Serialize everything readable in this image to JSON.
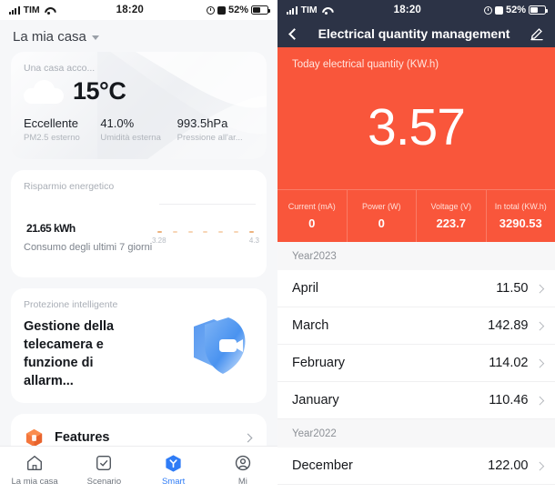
{
  "left": {
    "status_bar": {
      "carrier": "TIM",
      "time": "18:20",
      "battery_pct": "52%",
      "signal_icon": "signal-bars-icon",
      "wifi_icon": "wifi-icon",
      "location_icon": "location-icon",
      "alarm_icon": "alarm-icon",
      "battery_icon": "battery-icon"
    },
    "header": {
      "title": "La mia casa",
      "caret_icon": "chevron-down-icon"
    },
    "weather_card": {
      "label": "Una casa acco...",
      "icon": "cloud-icon",
      "temperature": "15°C",
      "stats": [
        {
          "value": "Eccellente",
          "key": "PM2.5 esterno"
        },
        {
          "value": "41.0%",
          "key": "Umidità esterna"
        },
        {
          "value": "993.5hPa",
          "key": "Pressione all'ar..."
        }
      ]
    },
    "energy_card": {
      "label": "Risparmio energetico",
      "value": "21.65",
      "unit": "kWh",
      "subtitle": "Consumo degli ultimi 7 giorni",
      "chart_min": "3.28",
      "chart_max": "4.3"
    },
    "protection_card": {
      "label": "Protezione intelligente",
      "title": "Gestione della telecamera e funzione di allarm...",
      "icon": "shield-camera-icon"
    },
    "features_row": {
      "icon": "orange-cube-icon",
      "label": "Features",
      "chevron_icon": "chevron-right-icon"
    },
    "tabbar": [
      {
        "label": "La mia casa",
        "icon": "home-icon",
        "active": false
      },
      {
        "label": "Scenario",
        "icon": "checkbox-icon",
        "active": false
      },
      {
        "label": "Smart",
        "icon": "smart-hex-icon",
        "active": true
      },
      {
        "label": "Mi",
        "icon": "person-circle-icon",
        "active": false
      }
    ],
    "colors": {
      "accent": "#2f7cf6",
      "card_bg": "#ffffff",
      "page_bg": "#f6f7f9"
    }
  },
  "right": {
    "status_bar": {
      "carrier": "TIM",
      "time": "18:20",
      "battery_pct": "52%",
      "signal_icon": "signal-bars-icon",
      "wifi_icon": "wifi-icon",
      "location_icon": "location-icon",
      "alarm_icon": "alarm-icon",
      "battery_icon": "battery-icon"
    },
    "nav": {
      "back_icon": "back-chevron-icon",
      "title": "Electrical quantity management",
      "edit_icon": "pencil-edit-icon"
    },
    "summary": {
      "label": "Today electrical quantity (KW.h)",
      "value": "3.57",
      "stats": [
        {
          "key": "Current  (mA)",
          "value": "0"
        },
        {
          "key": "Power (W)",
          "value": "0"
        },
        {
          "key": "Voltage (V)",
          "value": "223.7"
        },
        {
          "key": "In total (KW.h)",
          "value": "3290.53"
        }
      ]
    },
    "list": [
      {
        "type": "group",
        "label": "Year2023"
      },
      {
        "type": "row",
        "name": "April",
        "value": "11.50"
      },
      {
        "type": "row",
        "name": "March",
        "value": "142.89"
      },
      {
        "type": "row",
        "name": "February",
        "value": "114.02"
      },
      {
        "type": "row",
        "name": "January",
        "value": "110.46"
      },
      {
        "type": "group",
        "label": "Year2022"
      },
      {
        "type": "row",
        "name": "December",
        "value": "122.00"
      }
    ],
    "colors": {
      "accent": "#f9563b",
      "nav_bg": "#2c3346"
    }
  }
}
